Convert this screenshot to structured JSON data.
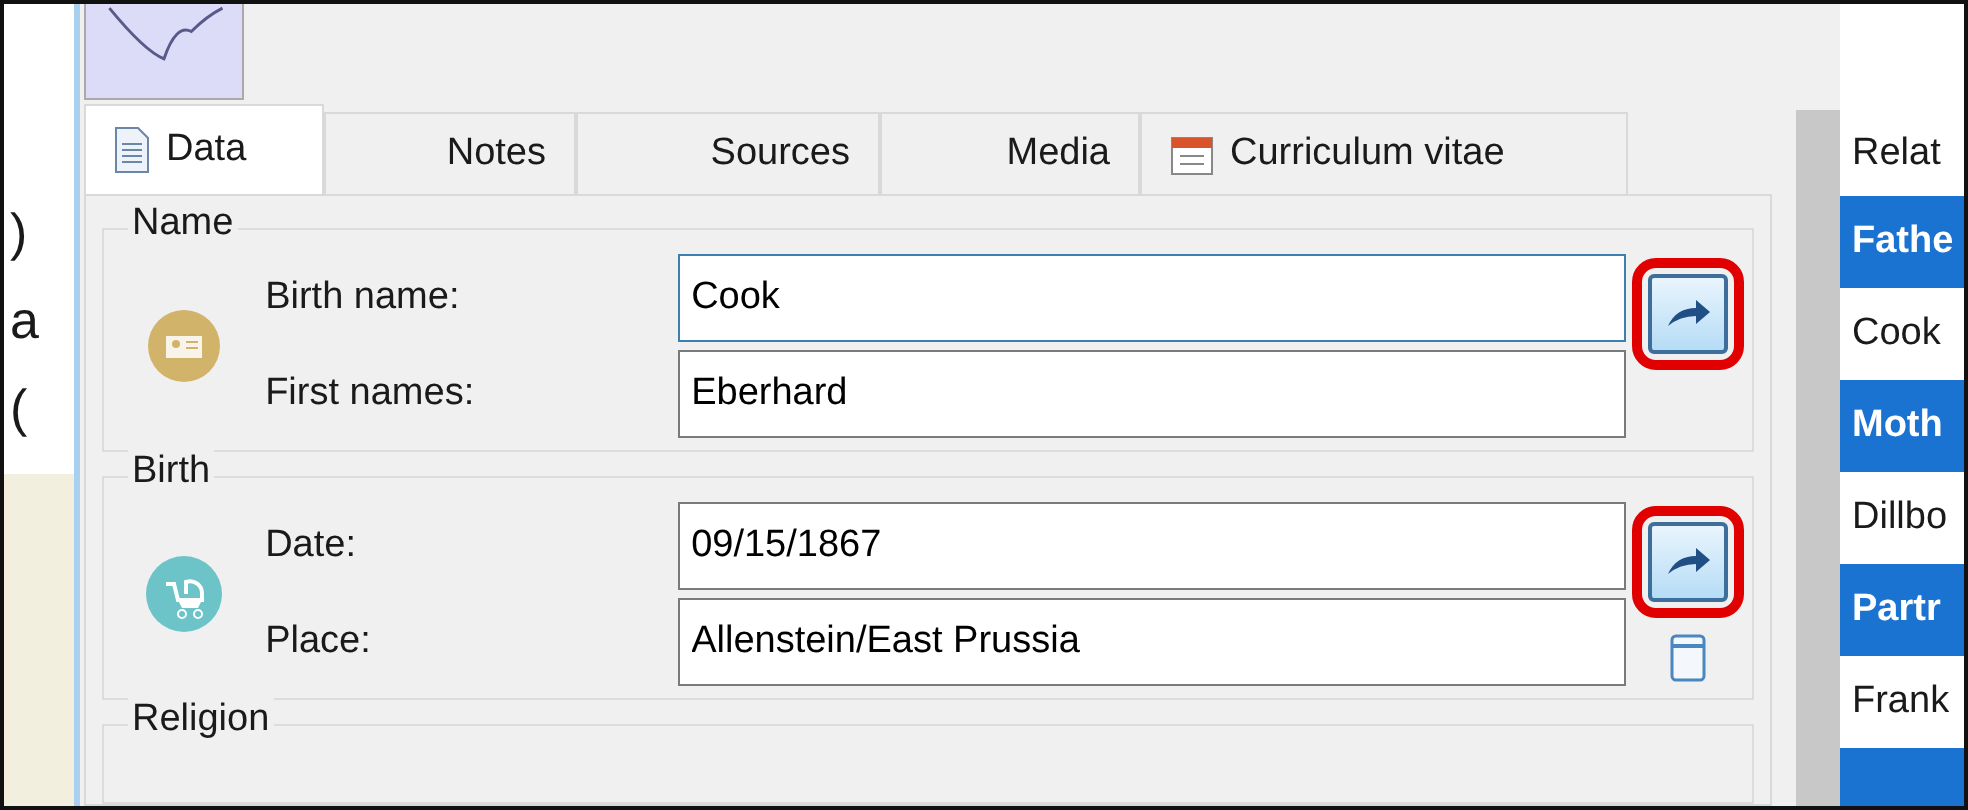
{
  "left_edge_texts": [
    ")",
    "a",
    "("
  ],
  "tabs": [
    {
      "label": "Data",
      "selected": true
    },
    {
      "label": "Notes",
      "selected": false
    },
    {
      "label": "Sources",
      "selected": false
    },
    {
      "label": "Media",
      "selected": false
    },
    {
      "label": "Curriculum vitae",
      "selected": false
    }
  ],
  "groups": [
    {
      "title": "Name",
      "fields": [
        {
          "label": "Birth name:",
          "value": "Cook",
          "focused": true
        },
        {
          "label": "First names:",
          "value": "Eberhard",
          "focused": false
        }
      ],
      "button": {
        "highlighted": true
      },
      "extra_icon": false
    },
    {
      "title": "Birth",
      "fields": [
        {
          "label": "Date:",
          "value": "09/15/1867",
          "focused": false
        },
        {
          "label": "Place:",
          "value": "Allenstein/East Prussia",
          "focused": false
        }
      ],
      "button": {
        "highlighted": true
      },
      "extra_icon": true
    },
    {
      "title": "Religion"
    }
  ],
  "relations": [
    {
      "label": "Relat",
      "kind": "title"
    },
    {
      "label": "Fathe",
      "kind": "header"
    },
    {
      "label": "Cook",
      "kind": "entry"
    },
    {
      "label": "Moth",
      "kind": "header"
    },
    {
      "label": "Dillbo",
      "kind": "entry"
    },
    {
      "label": "Partr",
      "kind": "header"
    },
    {
      "label": "Frank",
      "kind": "entry"
    },
    {
      "kind": "header"
    }
  ]
}
